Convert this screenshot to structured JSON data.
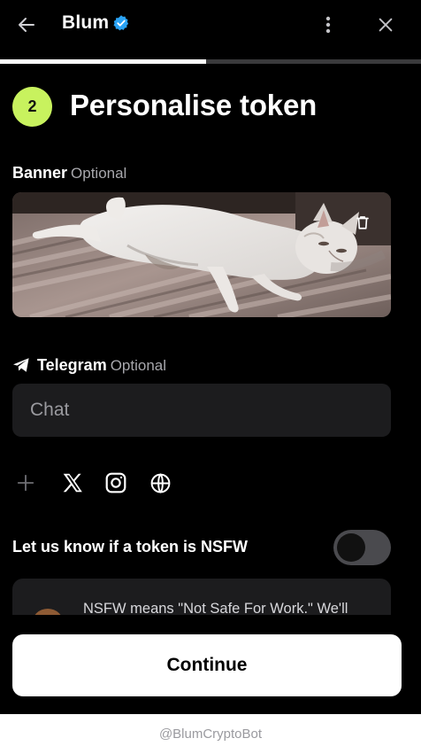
{
  "header": {
    "title": "Blum",
    "icons": {
      "back": "arrow-left-icon",
      "verified": "verified-badge-icon",
      "menu": "more-vertical-icon",
      "close": "close-icon"
    }
  },
  "progress": {
    "current": 1,
    "total": 2,
    "fraction": 0.49
  },
  "step": {
    "number": "2",
    "title": "Personalise token"
  },
  "banner": {
    "label": "Banner",
    "optional": "Optional",
    "icon": "trash-icon"
  },
  "telegram": {
    "label": "Telegram",
    "optional": "Optional",
    "icon": "telegram-icon",
    "placeholder": "Chat",
    "value": ""
  },
  "socials": [
    "add-link-icon",
    "x-twitter-icon",
    "instagram-icon",
    "globe-icon"
  ],
  "nsfw": {
    "label": "Let us know if a token is NSFW",
    "enabled": false,
    "info": "NSFW means \"Not Safe For Work.\" We'll"
  },
  "actions": {
    "continue_label": "Continue"
  },
  "footer": {
    "caption": "@BlumCryptoBot"
  },
  "colors": {
    "background": "#000000",
    "accent": "#c8f25e",
    "surface": "#1c1c1e",
    "verified": "#2aa3f5",
    "toggle_off": "#4a4a4e"
  }
}
